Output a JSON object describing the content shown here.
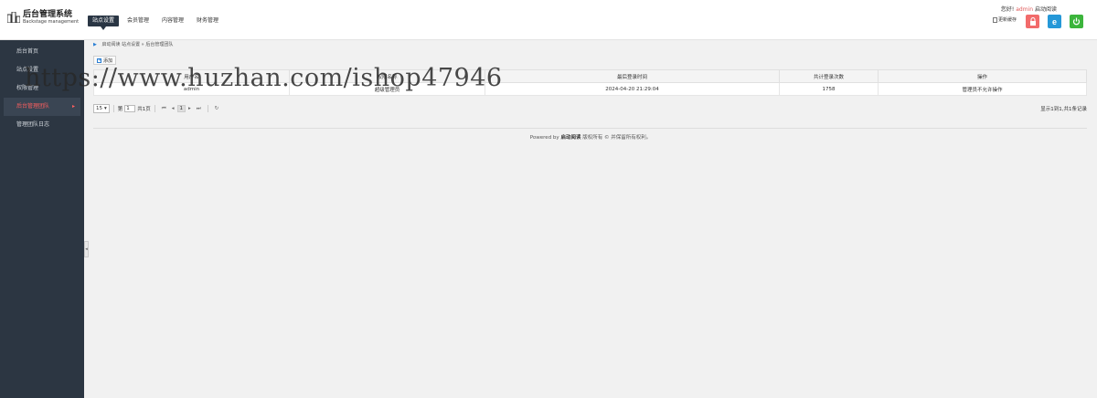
{
  "header": {
    "logo_title": "后台管理系统",
    "logo_sub": "Backstage management",
    "nav": [
      {
        "label": "站点设置",
        "active": true
      },
      {
        "label": "会员管理",
        "active": false
      },
      {
        "label": "内容管理",
        "active": false
      },
      {
        "label": "财务管理",
        "active": false
      }
    ],
    "greeting": "您好!",
    "username": "admin",
    "site_name": "启动阅读",
    "cache_label": "更新缓存"
  },
  "sidebar": {
    "items": [
      {
        "label": "后台首页"
      },
      {
        "label": "站点设置"
      },
      {
        "label": "权限管理"
      },
      {
        "label": "后台管理团队",
        "active": true
      },
      {
        "label": "管理团队日志"
      }
    ],
    "collapse_icon": "◂"
  },
  "breadcrumb": {
    "site": "启动阅读",
    "section": "站点设置",
    "sep": "»",
    "current": "后台管理团队"
  },
  "toolbar": {
    "add_label": "添加",
    "plus": "+"
  },
  "table": {
    "columns": [
      "用户名",
      "权限名称",
      "最后登录时间",
      "共计登录次数",
      "操作"
    ],
    "rows": [
      [
        "admin",
        "超级管理员",
        "2024-04-20 21:29:04",
        "1758",
        "管理员不允许操作"
      ]
    ]
  },
  "pager": {
    "page_size": "15",
    "page_label": "第",
    "page_input": "1",
    "total_pages": "共1页",
    "current_page": "1",
    "info": "显示1到1,共1条记录",
    "icons": {
      "first": "⏮",
      "prev": "◂",
      "next": "▸",
      "last": "⏭",
      "refresh": "↻"
    }
  },
  "footer": {
    "prefix": "Powered by",
    "site": "启动阅读",
    "suffix": "版权所有 © 并保留所有权利。"
  },
  "watermark": "https://www.huzhan.com/ishop47946",
  "colors": {
    "sidebar_bg": "#2c3642",
    "active_text": "#ff5f5f",
    "lock": "#f26b6b",
    "ie": "#2598d8",
    "power": "#3cb53c"
  }
}
